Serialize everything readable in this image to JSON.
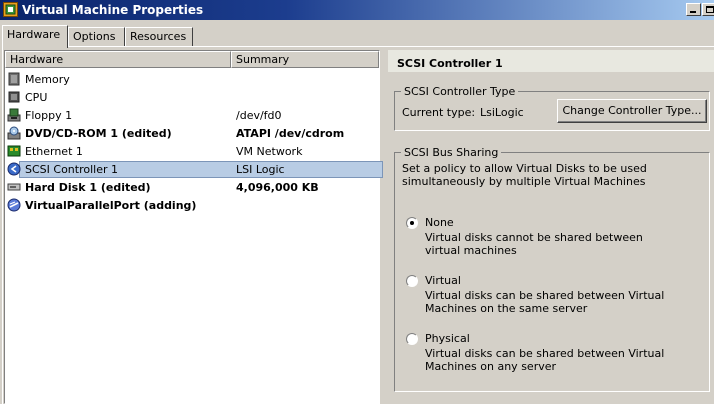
{
  "window": {
    "title": "Virtual Machine Properties"
  },
  "tabs": [
    "Hardware",
    "Options",
    "Resources"
  ],
  "hardware_list": {
    "columns": [
      "Hardware",
      "Summary"
    ],
    "rows": [
      {
        "name": "Memory",
        "summary": "",
        "icon": "memory-icon",
        "bold": false
      },
      {
        "name": "CPU",
        "summary": "",
        "icon": "cpu-icon",
        "bold": false
      },
      {
        "name": "Floppy 1",
        "summary": "/dev/fd0",
        "icon": "floppy-icon",
        "bold": false
      },
      {
        "name": "DVD/CD-ROM 1 (edited)",
        "summary": "ATAPI /dev/cdrom",
        "icon": "cdrom-icon",
        "bold": true
      },
      {
        "name": "Ethernet 1",
        "summary": "VM Network",
        "icon": "network-adapter-icon",
        "bold": false
      },
      {
        "name": "SCSI Controller 1",
        "summary": "LSI Logic",
        "icon": "scsi-controller-icon",
        "bold": false,
        "selected": true
      },
      {
        "name": "Hard Disk 1 (edited)",
        "summary": "4,096,000 KB",
        "icon": "hard-disk-icon",
        "bold": true
      },
      {
        "name": "VirtualParallelPort (adding)",
        "summary": "",
        "icon": "parallel-port-icon",
        "bold": true
      }
    ]
  },
  "details": {
    "title": "SCSI Controller 1",
    "controller_type": {
      "legend": "SCSI Controller Type",
      "current_label": "Current type:",
      "current_value": "LsiLogic",
      "change_button": "Change Controller Type..."
    },
    "bus_sharing": {
      "legend": "SCSI Bus Sharing",
      "description": "Set a policy to allow Virtual Disks to be used simultaneously by multiple Virtual Machines",
      "options": [
        {
          "label": "None",
          "desc": "Virtual disks cannot be shared between virtual machines",
          "selected": true
        },
        {
          "label": "Virtual",
          "desc": "Virtual disks can be shared between Virtual Machines on the same server",
          "selected": false
        },
        {
          "label": "Physical",
          "desc": "Virtual disks can be shared between Virtual Machines on any server",
          "selected": false
        }
      ]
    }
  },
  "colors": {
    "title_start": "#0a246a",
    "title_end": "#a6caf0",
    "selection": "#b8cce4",
    "face": "#d4d0c8"
  }
}
